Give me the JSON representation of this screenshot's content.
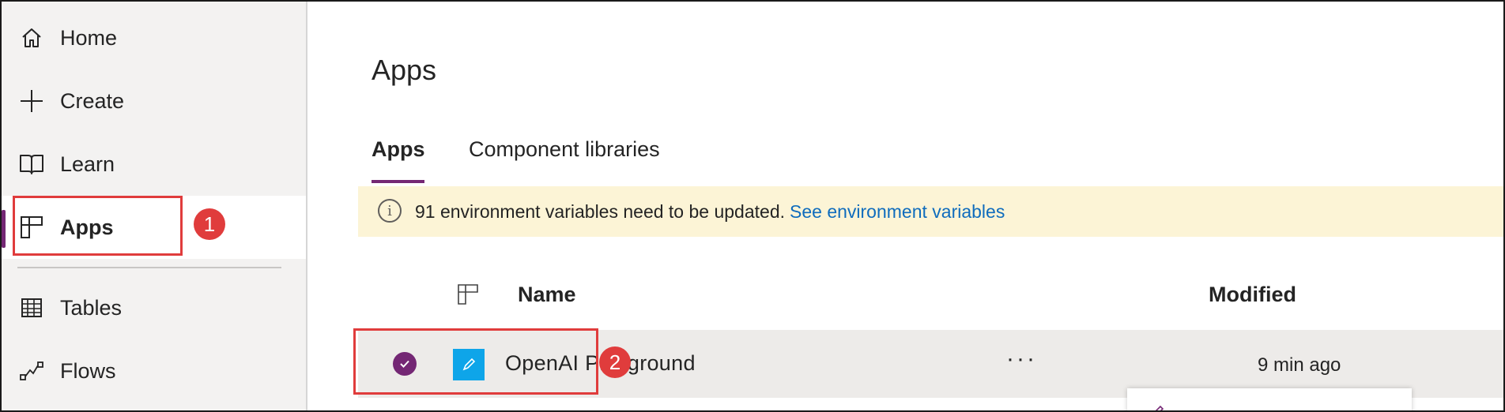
{
  "sidebar": {
    "items": [
      {
        "label": "Home",
        "icon": "home-icon"
      },
      {
        "label": "Create",
        "icon": "plus-icon"
      },
      {
        "label": "Learn",
        "icon": "book-icon"
      },
      {
        "label": "Apps",
        "icon": "apps-icon",
        "active": true
      },
      {
        "label": "Tables",
        "icon": "table-icon"
      },
      {
        "label": "Flows",
        "icon": "flow-icon"
      }
    ]
  },
  "callouts": {
    "first": "1",
    "second": "2"
  },
  "main": {
    "title": "Apps",
    "tabs": [
      {
        "label": "Apps",
        "selected": true
      },
      {
        "label": "Component libraries",
        "selected": false
      }
    ],
    "banner": {
      "message": "91 environment variables need to be updated.",
      "link": "See environment variables",
      "icon": "info-icon"
    },
    "table": {
      "columns": {
        "name": "Name",
        "modified": "Modified"
      },
      "rows": [
        {
          "name": "OpenAI Playground",
          "modified": "9 min ago",
          "selected": true,
          "more": "···"
        }
      ]
    }
  },
  "colors": {
    "accent": "#742774",
    "callout": "#e03c3c",
    "banner_bg": "#fcf4d6",
    "link": "#0f6cbd",
    "app_tile": "#0ea5e9"
  }
}
